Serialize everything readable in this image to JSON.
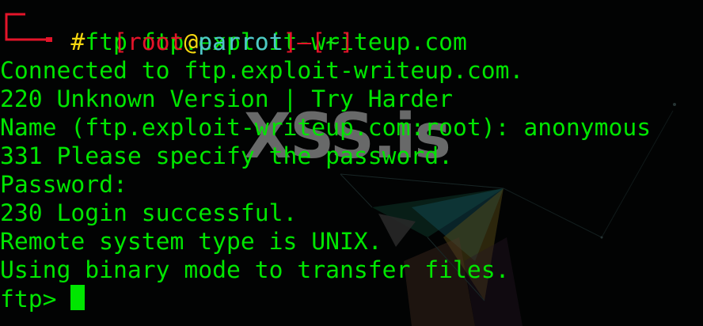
{
  "terminal": {
    "prompt": {
      "open_bracket": "[",
      "user": "root",
      "at": "@",
      "host": "parrot",
      "close_bracket": "]",
      "dash": "—",
      "dir_open": "[",
      "dir": "~",
      "dir_close": "]",
      "hash": "#",
      "command": "ftp ftp.exploit-writeup.com"
    },
    "output": [
      "Connected to ftp.exploit-writeup.com.",
      "220 Unknown Version | Try Harder",
      "Name (ftp.exploit-writeup.com:root): anonymous",
      "331 Please specify the password.",
      "Password:",
      "230 Login successful.",
      "Remote system type is UNIX.",
      "Using binary mode to transfer files."
    ],
    "ftp_prompt": "ftp> "
  },
  "watermark": "XSS.is",
  "colors": {
    "background": "#020303",
    "text_green": "#00e600",
    "prompt_red": "#e4142a",
    "prompt_yellow": "#f5d70f",
    "prompt_cyan": "#4ec6c8"
  }
}
